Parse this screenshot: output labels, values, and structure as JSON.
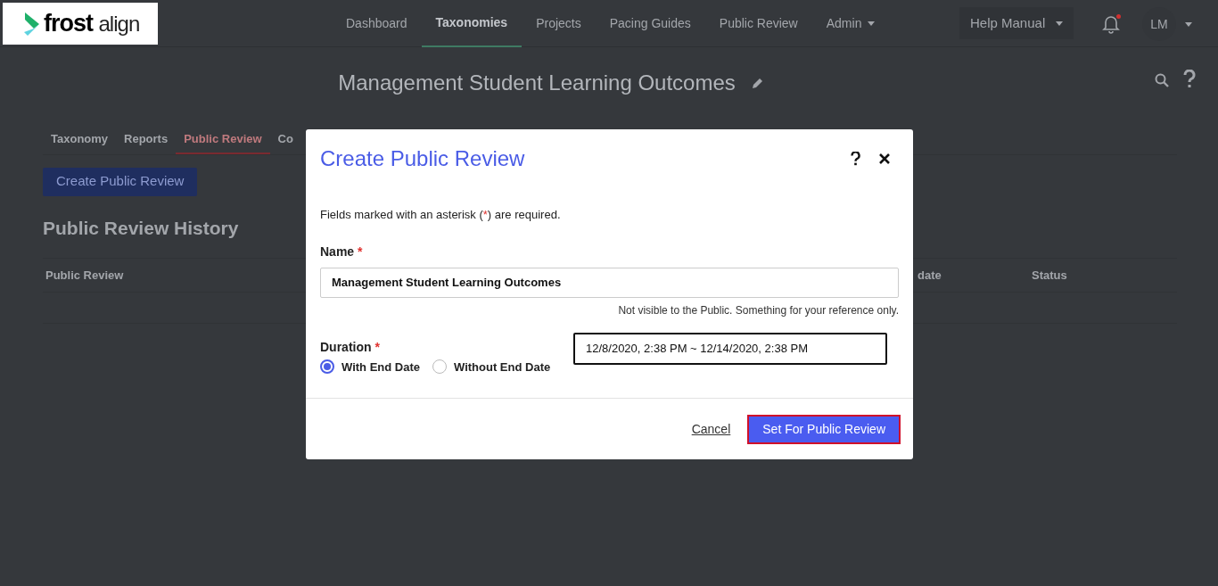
{
  "logo": {
    "bold": "frost",
    "light": "align"
  },
  "nav": [
    {
      "label": "Dashboard",
      "selected": false,
      "dropdown": false
    },
    {
      "label": "Taxonomies",
      "selected": true,
      "dropdown": false
    },
    {
      "label": "Projects",
      "selected": false,
      "dropdown": false
    },
    {
      "label": "Pacing Guides",
      "selected": false,
      "dropdown": false
    },
    {
      "label": "Public Review",
      "selected": false,
      "dropdown": false
    },
    {
      "label": "Admin",
      "selected": false,
      "dropdown": true
    }
  ],
  "help_menu": {
    "label": "Help Manual"
  },
  "notifications": {
    "unread": true
  },
  "user": {
    "initials": "LM"
  },
  "page_title": "Management Student Learning Outcomes",
  "tabs": [
    {
      "label": "Taxonomy",
      "selected": false
    },
    {
      "label": "Reports",
      "selected": false
    },
    {
      "label": "Public Review",
      "selected": true
    },
    {
      "label": "Co",
      "selected": false
    }
  ],
  "create_button": "Create Public Review",
  "history_heading": "Public Review History",
  "table": {
    "columns": [
      "Public Review",
      "date",
      "Status"
    ]
  },
  "dialog": {
    "title": "Create Public Review",
    "required_note": [
      "Fields marked with an asterisk (",
      "*",
      ") are required."
    ],
    "name_field": {
      "label": "Name",
      "required": true,
      "value": "Management Student Learning Outcomes",
      "hint": "Not visible to the Public. Something for your reference only."
    },
    "duration": {
      "label": "Duration",
      "required": true,
      "options": [
        {
          "label": "With End Date",
          "selected": true
        },
        {
          "label": "Without End Date",
          "selected": false
        }
      ],
      "value": "12/8/2020, 2:38 PM ~ 12/14/2020, 2:38 PM"
    },
    "cancel": "Cancel",
    "submit": "Set For Public Review"
  }
}
